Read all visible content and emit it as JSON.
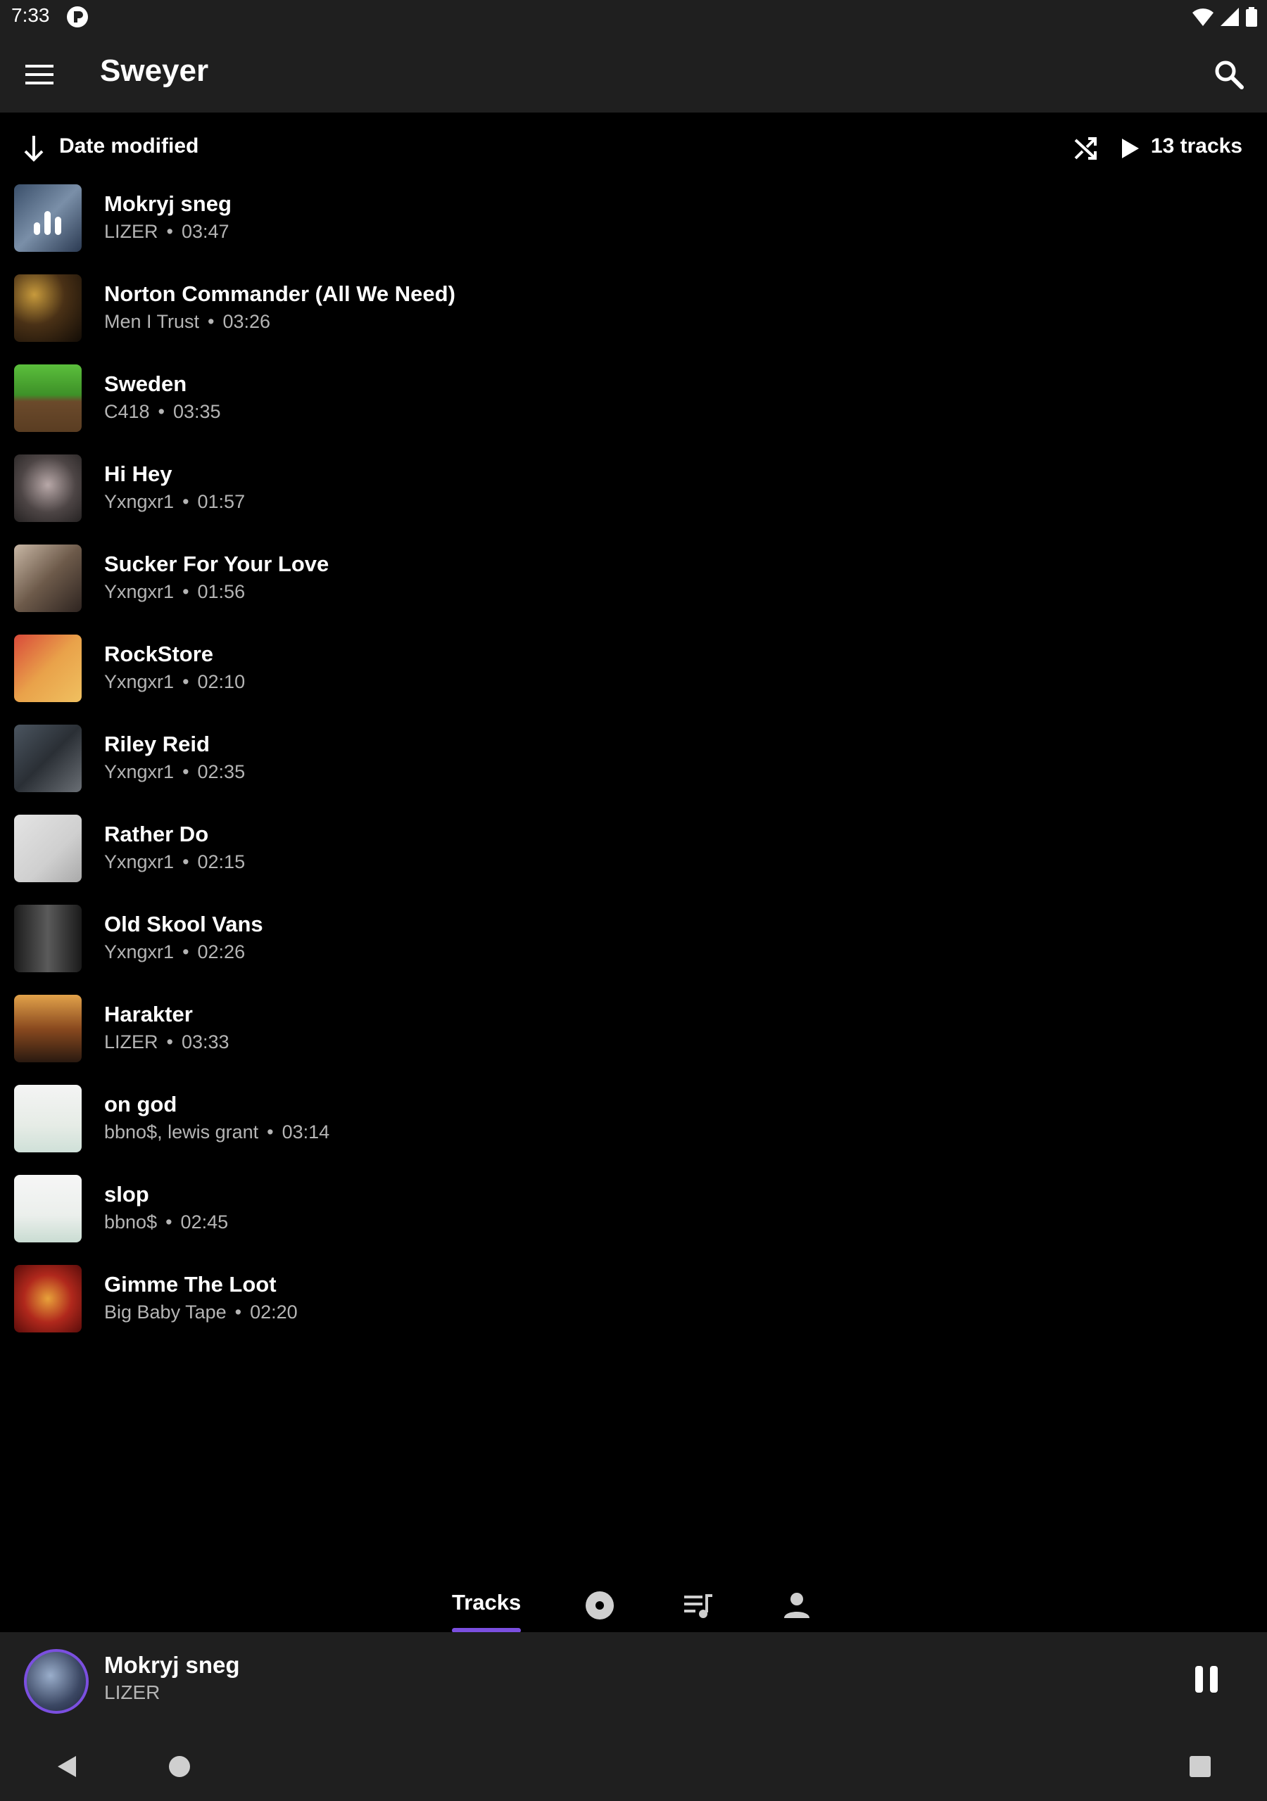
{
  "status_bar": {
    "time": "7:33"
  },
  "app_bar": {
    "title": "Sweyer"
  },
  "sort_bar": {
    "sort_label": "Date modified",
    "track_count": "13 tracks"
  },
  "tracks": [
    {
      "title": "Mokryj sneg",
      "artist": "LIZER",
      "duration": "03:47"
    },
    {
      "title": "Norton Commander (All We Need)",
      "artist": "Men I Trust",
      "duration": "03:26"
    },
    {
      "title": "Sweden",
      "artist": "C418",
      "duration": "03:35"
    },
    {
      "title": "Hi Hey",
      "artist": "Yxngxr1",
      "duration": "01:57"
    },
    {
      "title": "Sucker For Your Love",
      "artist": "Yxngxr1",
      "duration": "01:56"
    },
    {
      "title": "RockStore",
      "artist": "Yxngxr1",
      "duration": "02:10"
    },
    {
      "title": "Riley Reid",
      "artist": "Yxngxr1",
      "duration": "02:35"
    },
    {
      "title": "Rather Do",
      "artist": "Yxngxr1",
      "duration": "02:15"
    },
    {
      "title": "Old Skool Vans",
      "artist": "Yxngxr1",
      "duration": "02:26"
    },
    {
      "title": "Harakter",
      "artist": "LIZER",
      "duration": "03:33"
    },
    {
      "title": "on god",
      "artist": "bbno$, lewis grant",
      "duration": "03:14"
    },
    {
      "title": "slop",
      "artist": "bbno$",
      "duration": "02:45"
    },
    {
      "title": "Gimme The Loot",
      "artist": "Big Baby Tape",
      "duration": "02:20"
    }
  ],
  "bottom_nav": {
    "tracks_label": "Tracks"
  },
  "mini_player": {
    "title": "Mokryj sneg",
    "artist": "LIZER"
  },
  "colors": {
    "accent": "#7b4fe0",
    "surface": "#1f1f1f",
    "background": "#000000",
    "secondary_text": "#b5b5b5"
  },
  "icons": [
    "menu-icon",
    "search-icon",
    "sort-arrow-icon",
    "shuffle-icon",
    "play-icon",
    "album-icon",
    "playlist-icon",
    "artist-icon",
    "pause-icon",
    "back-icon",
    "home-icon",
    "recents-icon",
    "equalizer-icon"
  ]
}
